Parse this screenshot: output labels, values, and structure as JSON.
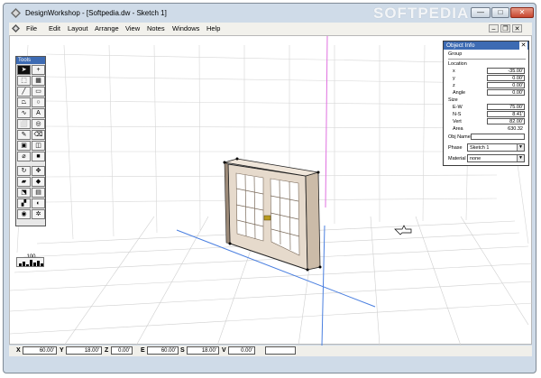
{
  "window": {
    "title": "DesignWorkshop - [Softpedia.dw - Sketch 1]",
    "watermark": "SOFTPEDIA",
    "min_glyph": "—",
    "max_glyph": "□",
    "close_glyph": "✕"
  },
  "menu": {
    "items": [
      "File",
      "Edit",
      "Layout",
      "Arrange",
      "View",
      "Notes",
      "Windows",
      "Help"
    ],
    "mdi_min": "–",
    "mdi_restore": "❐",
    "mdi_close": "✕"
  },
  "tools": {
    "title": "Tools",
    "icons": [
      "pointer-tool-icon",
      "add-point-tool-icon",
      "selection-tool-icon",
      "grid-tool-icon",
      "line-tool-icon",
      "rectangle-tool-icon",
      "polygon-tool-icon",
      "circle-tool-icon",
      "curve-tool-icon",
      "text-tool-icon",
      "box-tool-icon",
      "cylinder-tool-icon",
      "pencil-tool-icon",
      "eraser-tool-icon",
      "wall-tool-icon",
      "opening-tool-icon",
      "eyedropper-tool-icon",
      "camera-tool-icon",
      "rotate-tool-icon",
      "move-tool-icon",
      "paint-tool-icon",
      "surface-tool-icon",
      "extrude-tool-icon",
      "door-tool-icon",
      "stairs-tool-icon",
      "view-angle-tool-icon",
      "eye-tool-icon",
      "compass-tool-icon"
    ],
    "zoom": "100"
  },
  "object_info": {
    "title": "Object Info",
    "close_glyph": "✕",
    "group_label": "Group",
    "location_label": "Location",
    "x_label": "x",
    "x_value": "-35.00'",
    "y_label": "y",
    "y_value": "0.00'",
    "z_label": "z",
    "z_value": "0.00'",
    "angle_label": "Angle",
    "angle_value": "0.00'",
    "size_label": "Size",
    "ew_label": "E-W",
    "ew_value": "75.00'",
    "ns_label": "N-S",
    "ns_value": "8.41'",
    "vert_label": "Vert",
    "vert_value": "82.00'",
    "area_label": "Area",
    "area_value": "630.32",
    "obj_name_label": "Obj Name",
    "obj_name_value": "",
    "phase_label": "Phase",
    "phase_value": "Sketch 1",
    "material_label": "Material",
    "material_value": "none",
    "dropdown_arrow": "▼"
  },
  "status_bar": {
    "x_label": "X",
    "x_value": "60.00'",
    "y_label": "Y",
    "y_value": "18.00'",
    "z_label": "Z",
    "z_value": "0.00'",
    "e_label": "E",
    "e_value": "60.00'",
    "s_label": "S",
    "s_value": "18.00'",
    "v_label": "V",
    "v_value": "0.00'",
    "extra_value": ""
  },
  "colors": {
    "titlebar": "#cfdbe8",
    "grid": "#cccccc",
    "axis_blue": "#4a7fe0",
    "axis_magenta": "#e070e0",
    "door_frame": "#d8c8b8",
    "panel_title": "#3d6bb3"
  }
}
